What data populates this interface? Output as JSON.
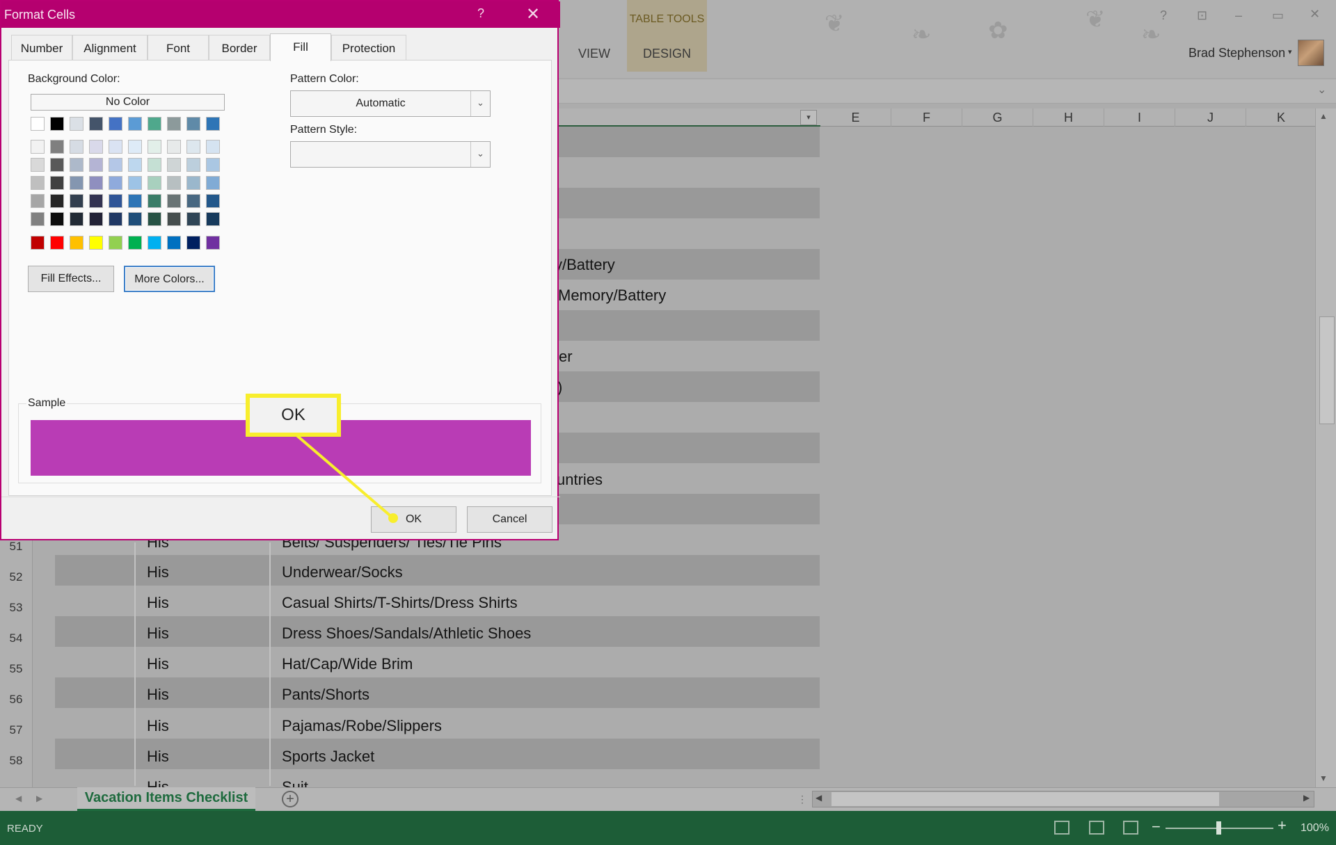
{
  "window": {
    "help_glyph": "?",
    "restore_glyph": "⊡",
    "minimize_glyph": "–",
    "maximize_glyph": "▭",
    "close_glyph": "✕"
  },
  "ribbon": {
    "contextual_group": "TABLE TOOLS",
    "tabs": {
      "view": "VIEW",
      "design": "DESIGN"
    },
    "user_name": "Brad Stephenson",
    "user_caret": "▾",
    "collapse_glyph": "⌄"
  },
  "columns": [
    "E",
    "F",
    "G",
    "H",
    "I",
    "J",
    "K"
  ],
  "filter_glyph": "▾",
  "rows": [
    {
      "num": "51",
      "category": "His",
      "item": "Belts/ Suspenders/ Ties/Tie Pins"
    },
    {
      "num": "52",
      "category": "His",
      "item": "Underwear/Socks"
    },
    {
      "num": "53",
      "category": "His",
      "item": "Casual Shirts/T-Shirts/Dress Shirts"
    },
    {
      "num": "54",
      "category": "His",
      "item": "Dress Shoes/Sandals/Athletic Shoes"
    },
    {
      "num": "55",
      "category": "His",
      "item": "Hat/Cap/Wide Brim"
    },
    {
      "num": "56",
      "category": "His",
      "item": "Pants/Shorts"
    },
    {
      "num": "57",
      "category": "His",
      "item": "Pajamas/Robe/Slippers"
    },
    {
      "num": "58",
      "category": "His",
      "item": "Sports Jacket"
    },
    {
      "num": "",
      "category": "His",
      "item": "Suit"
    }
  ],
  "partial_cells": [
    "y/Battery",
    "Memory/Battery",
    "er",
    ")",
    "untries"
  ],
  "sheet": {
    "tab_name": "Vacation Items Checklist",
    "add_glyph": "+",
    "nav_left": "◀",
    "nav_right": "▶",
    "split_glyph": "⋮"
  },
  "scroll": {
    "up": "▲",
    "down": "▼",
    "left": "◀",
    "right": "▶"
  },
  "status": {
    "text": "READY",
    "zoom_minus": "−",
    "zoom_plus": "+",
    "zoom_level": "100%",
    "zoom_value_percent": 100
  },
  "dialog": {
    "title": "Format Cells",
    "help": "?",
    "close": "✕",
    "tabs": [
      "Number",
      "Alignment",
      "Font",
      "Border",
      "Fill",
      "Protection"
    ],
    "active_tab": "Fill",
    "background_color_label": "Background Color:",
    "no_color_label": "No Color",
    "pattern_color_label": "Pattern Color:",
    "pattern_color_value": "Automatic",
    "pattern_style_label": "Pattern Style:",
    "pattern_style_value": "",
    "dropdown_glyph": "⌄",
    "fill_effects_label": "Fill Effects...",
    "more_colors_label": "More Colors...",
    "sample_label": "Sample",
    "sample_color": "#b93cb5",
    "ok_label": "OK",
    "cancel_label": "Cancel",
    "theme_colors": [
      [
        "#ffffff",
        "#000000",
        "#dbe0e6",
        "#44546a",
        "#4472c4",
        "#5b9bd5",
        "#4fa88c",
        "#8c9a9b",
        "#5f8aa8",
        "#2e75b6"
      ],
      [
        "#f2f2f2",
        "#7f7f7f",
        "#d6dce4",
        "#d9d9ea",
        "#dae3f3",
        "#deebf7",
        "#e2efe9",
        "#e7eaea",
        "#dde7ee",
        "#d5e3f1"
      ],
      [
        "#d9d9d9",
        "#595959",
        "#adb9ca",
        "#b4b4d4",
        "#b4c7e7",
        "#bdd7ee",
        "#c5e0d4",
        "#cfd5d6",
        "#bccfdd",
        "#aac7e3"
      ],
      [
        "#bfbfbf",
        "#404040",
        "#8496b0",
        "#8f8fbf",
        "#8faadc",
        "#9dc3e6",
        "#a8d0be",
        "#b7bfc1",
        "#9ab7cc",
        "#80abd5"
      ],
      [
        "#a6a6a6",
        "#262626",
        "#323f4f",
        "#333352",
        "#2f5597",
        "#2e75b6",
        "#3a7d68",
        "#697475",
        "#476781",
        "#22578a"
      ],
      [
        "#808080",
        "#0d0d0d",
        "#222a35",
        "#222236",
        "#203864",
        "#1f4e79",
        "#275345",
        "#464e4e",
        "#2f4556",
        "#173a5c"
      ]
    ],
    "standard_colors": [
      "#c00000",
      "#ff0000",
      "#ffc000",
      "#ffff00",
      "#92d050",
      "#00b050",
      "#00b0f0",
      "#0070c0",
      "#002060",
      "#7030a0"
    ]
  },
  "callout": {
    "label": "OK",
    "color": "#f8ee2d"
  },
  "colors": {
    "dialog_accent": "#b5006f",
    "status_bar": "#1d5d37",
    "sheet_tab_text": "#1e6b3e"
  }
}
